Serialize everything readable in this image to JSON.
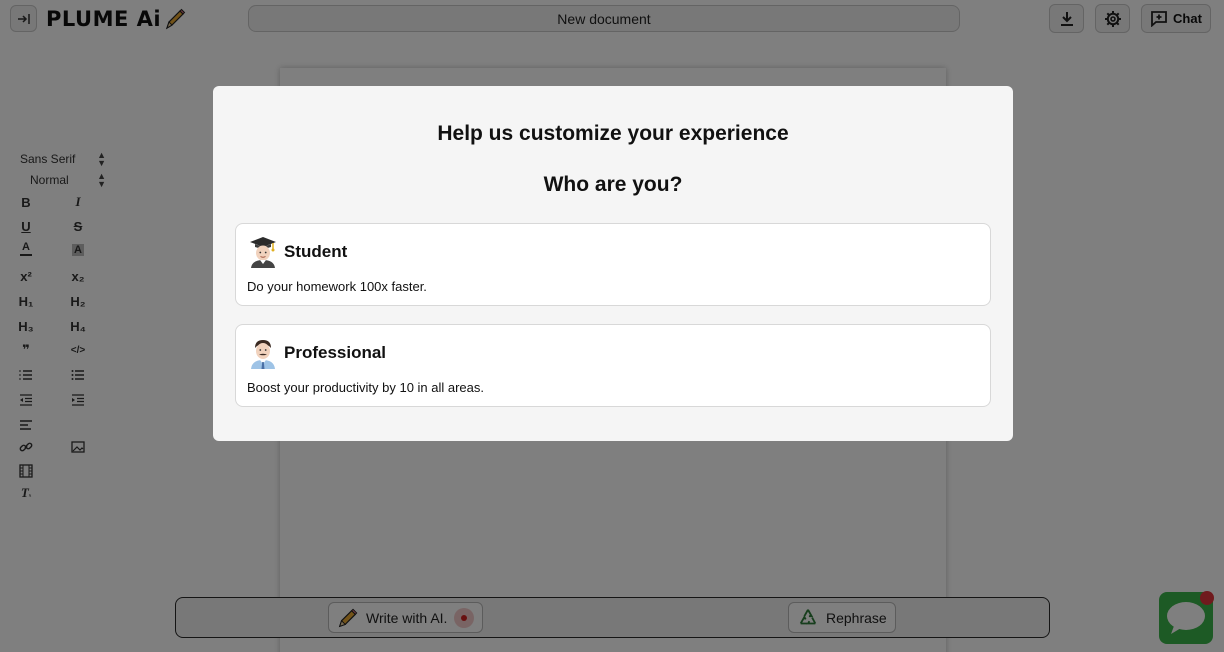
{
  "app": {
    "logo_text": "PLUME Ai",
    "document_title": "New document",
    "chat_label": "Chat"
  },
  "editor_toolbar": {
    "font_family": "Sans Serif",
    "font_size": "Normal",
    "tools": [
      {
        "name": "bold",
        "label": "B"
      },
      {
        "name": "italic",
        "label": "I"
      },
      {
        "name": "underline",
        "label": "U"
      },
      {
        "name": "strike",
        "label": "S"
      },
      {
        "name": "text-color",
        "label": "A"
      },
      {
        "name": "highlight",
        "label": "A"
      },
      {
        "name": "superscript",
        "label": "x²"
      },
      {
        "name": "subscript",
        "label": "x₂"
      },
      {
        "name": "heading-1",
        "label": "H₁"
      },
      {
        "name": "heading-2",
        "label": "H₂"
      },
      {
        "name": "heading-3",
        "label": "H₃"
      },
      {
        "name": "heading-4",
        "label": "H₄"
      },
      {
        "name": "blockquote",
        "label": "❞"
      },
      {
        "name": "code-block",
        "label": "</>"
      },
      {
        "name": "ordered-list",
        "label": ""
      },
      {
        "name": "bullet-list",
        "label": ""
      },
      {
        "name": "outdent",
        "label": ""
      },
      {
        "name": "indent",
        "label": ""
      },
      {
        "name": "align",
        "label": ""
      },
      {
        "name": "link",
        "label": ""
      },
      {
        "name": "image",
        "label": ""
      },
      {
        "name": "video",
        "label": ""
      },
      {
        "name": "clear-format",
        "label": "T"
      }
    ]
  },
  "bottom_bar": {
    "write_label": "Write with AI.",
    "rephrase_label": "Rephrase"
  },
  "modal": {
    "title": "Help us customize your experience",
    "subtitle": "Who are you?",
    "options": [
      {
        "emoji": "student",
        "name": "Student",
        "description": "Do your homework 100x faster."
      },
      {
        "emoji": "professional",
        "name": "Professional",
        "description": "Boost your productivity by 10 in all areas."
      }
    ]
  },
  "colors": {
    "overlay": "rgba(0,0,0,0.5)",
    "chat_widget": "#3ab54a",
    "notification": "#e0353a",
    "record_dot": "#d02020"
  }
}
